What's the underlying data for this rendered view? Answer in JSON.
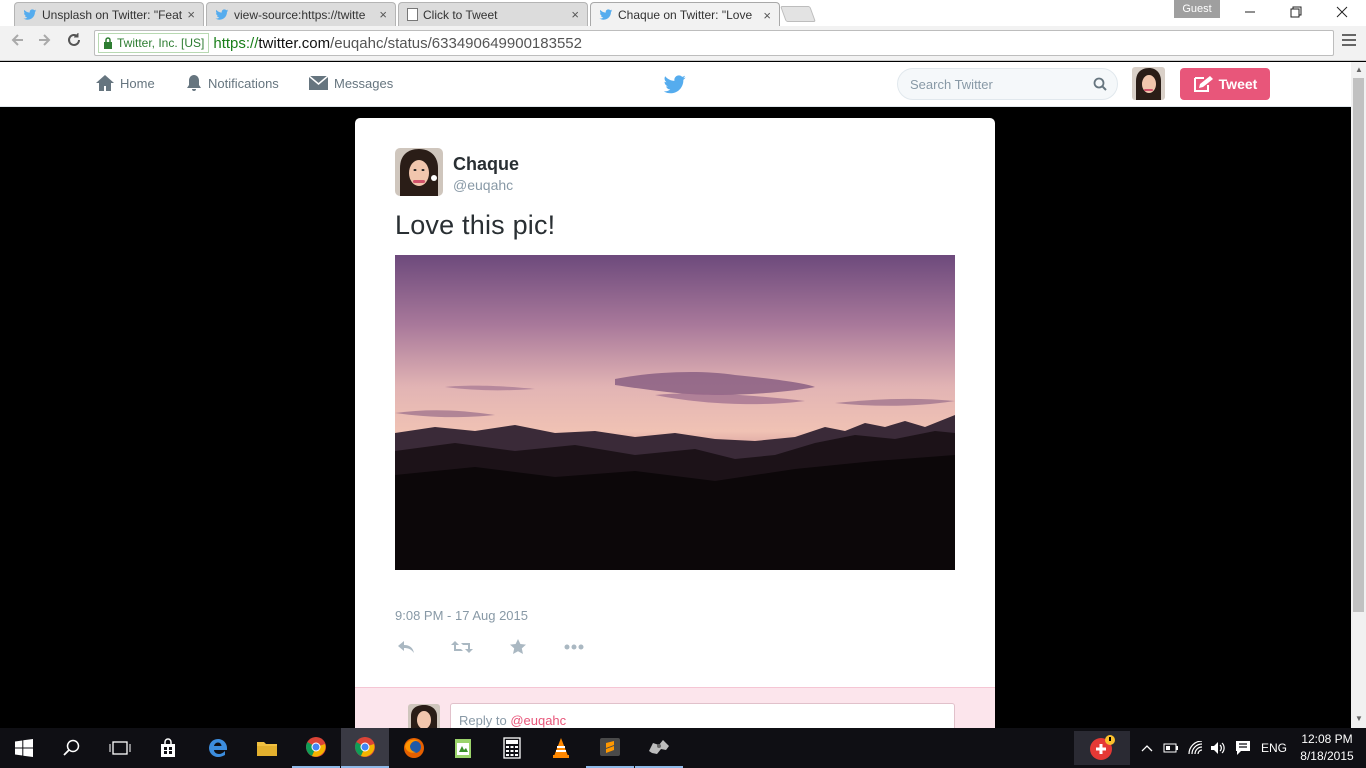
{
  "browser": {
    "tabs": [
      {
        "title": "Unsplash on Twitter: \"Feat",
        "favicon": "twitter-bird-icon"
      },
      {
        "title": "view-source:https://twitte",
        "favicon": "twitter-bird-icon"
      },
      {
        "title": "Click to Tweet",
        "favicon": "page-icon"
      },
      {
        "title": "Chaque on Twitter: \"Love",
        "favicon": "twitter-bird-icon"
      }
    ],
    "close_glyph": "×",
    "profile_label": "Guest",
    "ev_label": "Twitter, Inc. [US]",
    "url_scheme": "https://",
    "url_host": "twitter.com",
    "url_path": "/euqahc/status/633490649900183552"
  },
  "twitter_nav": {
    "home_label": "Home",
    "notifications_label": "Notifications",
    "messages_label": "Messages",
    "search_placeholder": "Search Twitter",
    "tweet_button_label": "Tweet",
    "accent_color": "#e8567a",
    "brand_color": "#55acee"
  },
  "tweet": {
    "author_name": "Chaque",
    "author_handle": "@euqahc",
    "text": "Love this pic!",
    "timestamp": "9:08 PM - 17 Aug 2015",
    "actions": [
      "reply-icon",
      "retweet-icon",
      "favorite-icon",
      "more-icon"
    ],
    "reply_prefix": "Reply to ",
    "reply_mention": "@euqahc"
  },
  "taskbar": {
    "apps": [
      "start-icon",
      "search-icon",
      "task-view-icon",
      "store-icon",
      "edge-icon",
      "file-explorer-icon",
      "chrome-icon",
      "chrome-icon",
      "firefox-icon",
      "notepad-icon",
      "calculator-icon",
      "vlc-icon",
      "sublime-icon",
      "app-icon"
    ],
    "language": "ENG",
    "time": "12:08 PM",
    "date": "8/18/2015"
  }
}
